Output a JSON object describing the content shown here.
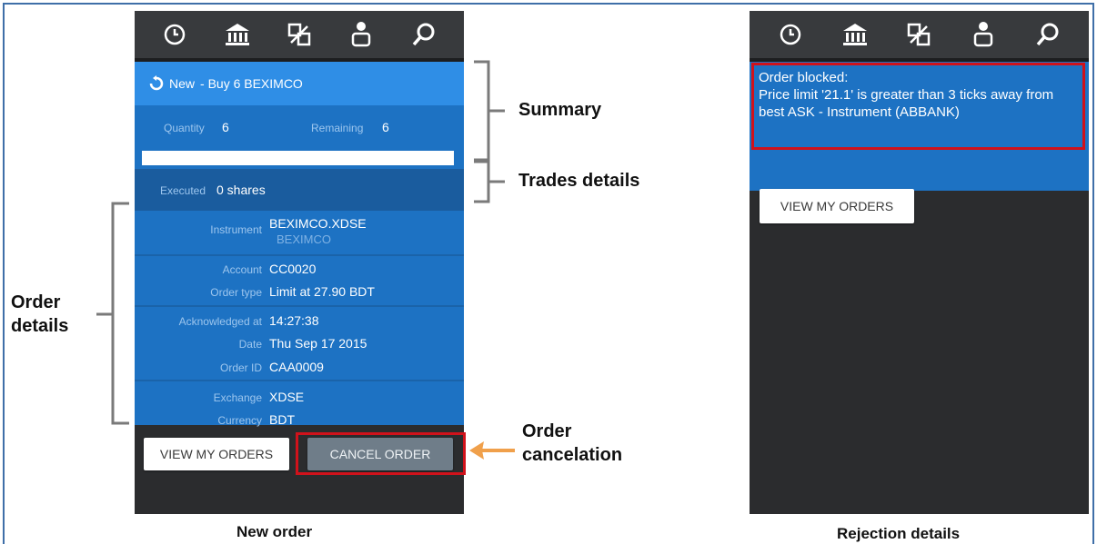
{
  "left_screen": {
    "summary": {
      "status": "New",
      "title": "- Buy 6 BEXIMCO",
      "quantity_label": "Quantity",
      "quantity_value": "6",
      "remaining_label": "Remaining",
      "remaining_value": "6",
      "progress_fraction": 0.0
    },
    "trades": {
      "executed_label": "Executed",
      "executed_value": "0 shares"
    },
    "details": {
      "instrument_label": "Instrument",
      "instrument_value": "BEXIMCO.XDSE",
      "instrument_sub": "BEXIMCO",
      "account_label": "Account",
      "account_value": "CC0020",
      "order_type_label": "Order type",
      "order_type_value": "Limit at 27.90 BDT",
      "acknowledged_label": "Acknowledged at",
      "acknowledged_value": "14:27:38",
      "date_label": "Date",
      "date_value": "Thu Sep 17 2015",
      "order_id_label": "Order ID",
      "order_id_value": "CAA0009",
      "exchange_label": "Exchange",
      "exchange_value": "XDSE",
      "currency_label": "Currency",
      "currency_value": "BDT"
    },
    "buttons": {
      "view_orders": "VIEW MY ORDERS",
      "cancel_order": "CANCEL ORDER"
    }
  },
  "right_screen": {
    "reject_title": "Order blocked:",
    "reject_message": "Price limit '21.1' is greater than 3 ticks away from best ASK - Instrument (ABBANK)",
    "view_orders": "VIEW MY ORDERS"
  },
  "annotations": {
    "summary": "Summary",
    "trades_details": "Trades details",
    "order_details_line1": "Order",
    "order_details_line2": "details",
    "order_cancel_line1": "Order",
    "order_cancel_line2": "cancelation",
    "caption_left": "New order",
    "caption_right": "Rejection details"
  },
  "icons": {
    "nav": [
      "clock-icon",
      "bank-icon",
      "transfer-icon",
      "user-icon",
      "search-icon"
    ],
    "status": "refresh-icon",
    "arrow": "arrow-left-icon"
  },
  "colors": {
    "accent_blue": "#1d72c3",
    "header_blue": "#2f8ee6",
    "highlight_red": "#d0121b",
    "arrow_orange": "#f0a04b"
  }
}
